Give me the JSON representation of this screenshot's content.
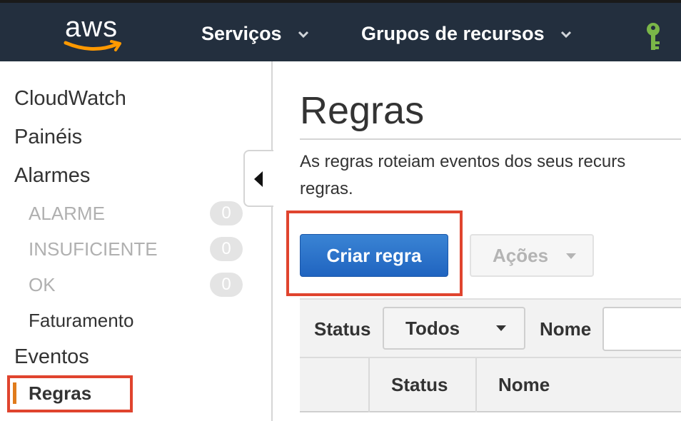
{
  "topbar": {
    "logo_text": "aws",
    "nav_services": "Serviços",
    "nav_resource_groups": "Grupos de recursos",
    "icons": [
      "chevron-down-icon",
      "key-icon"
    ]
  },
  "sidebar": {
    "cloudwatch": "CloudWatch",
    "dashboards": "Painéis",
    "alarms": "Alarmes",
    "alarm_states": [
      {
        "label": "ALARME",
        "count": "0"
      },
      {
        "label": "INSUFICIENTE",
        "count": "0"
      },
      {
        "label": "OK",
        "count": "0"
      }
    ],
    "billing": "Faturamento",
    "events": "Eventos",
    "rules": "Regras"
  },
  "main": {
    "title": "Regras",
    "description_line1": "As regras roteiam eventos dos seus recurs",
    "description_line2": "regras.",
    "create_button": "Criar regra",
    "actions_button": "Ações",
    "filter": {
      "status_label": "Status",
      "status_value": "Todos",
      "name_label": "Nome",
      "name_value": ""
    },
    "table_headers": [
      "Status",
      "Nome"
    ]
  },
  "colors": {
    "topbar_bg": "#232f3e",
    "primary_button": "#2a72cc",
    "highlight_box": "#e0442e",
    "active_marker": "#e07b1c",
    "key_icon": "#7ab648"
  }
}
